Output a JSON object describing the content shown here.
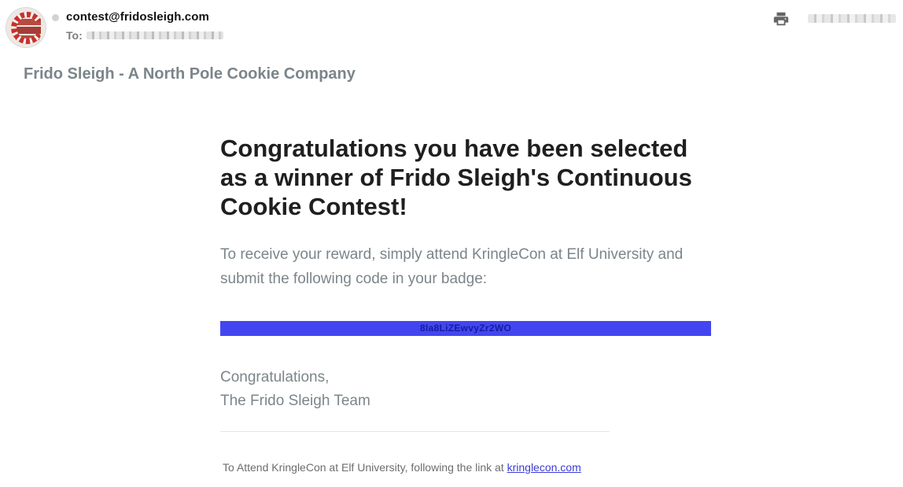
{
  "header": {
    "from_email": "contest@fridosleigh.com",
    "to_label": "To:",
    "print_icon": "printer-icon",
    "sender_avatar_icon": "candy-cane-c-logo"
  },
  "brand": {
    "name": "Frido Sleigh - A North Pole Cookie Company"
  },
  "message": {
    "headline": "Congratulations you have been selected as a winner of Frido Sleigh's Continuous Cookie Contest!",
    "body": "To receive your reward, simply attend KringleCon at Elf University and submit the following code in your badge:",
    "code": "8Ia8LiZEwvyZr2WO",
    "signoff_line1": "Congratulations,",
    "signoff_line2": "The Frido Sleigh Team"
  },
  "footer": {
    "text": "To Attend KringleCon at Elf University, following the link at",
    "link_text": "kringlecon.com"
  },
  "colors": {
    "code_bar": "#4346f0",
    "muted_text": "#7b858a",
    "link": "#3b3bd6"
  }
}
